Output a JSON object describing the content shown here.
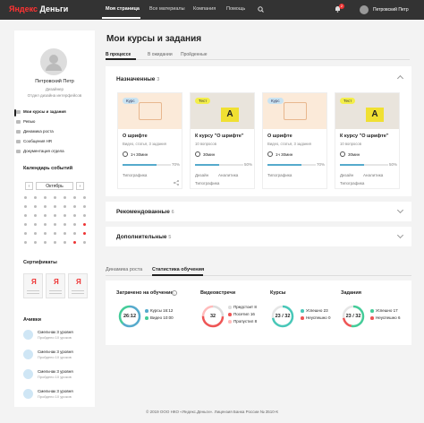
{
  "header": {
    "logo_ya": "Яндекс",
    "logo_rest": "Деньги",
    "nav": [
      "Моя страница",
      "Все материалы",
      "Компания",
      "Помощь"
    ],
    "notifications": "2",
    "user": "Петровский Петр"
  },
  "sidebar": {
    "name": "Петровский Петр",
    "role": "Дизайнер",
    "department": "Отдел дизайна интерфейсов",
    "menu": [
      "Мои курсы и задания",
      "Ревью",
      "Динамика роста",
      "Сообщения HR",
      "Документация отдела"
    ],
    "calendar_title": "Календарь событий",
    "calendar_prev": "‹",
    "calendar_next": "›",
    "calendar_month": "Октябрь",
    "certificates_title": "Сертификаты",
    "achievements_title": "Ачивки",
    "achievements": [
      {
        "title": "Смельчак 3 уровня",
        "sub": "Пройдено 10 уроков"
      },
      {
        "title": "Смельчак 3 уровня",
        "sub": "Пройдено 10 уроков"
      },
      {
        "title": "Смельчак 3 уровня",
        "sub": "Пройдено 10 уроков"
      },
      {
        "title": "Смельчак 3 уровня",
        "sub": "Пройдено 10 уроков"
      }
    ]
  },
  "main": {
    "title": "Мои курсы и задания",
    "tabs": [
      "В процессе",
      "В ожидании",
      "Пройденные"
    ],
    "assigned": {
      "title": "Назначенные",
      "count": "3"
    },
    "cards": [
      {
        "tag": "Курс",
        "title": "О шрифте",
        "meta": "Видео, статья, 3 задания",
        "time": "1ч 30мин",
        "progress": 70,
        "pct": "70%",
        "tags": [
          "Типографика"
        ]
      },
      {
        "tag": "Тест",
        "title": "К курсу \"О шрифте\"",
        "meta": "10 вопросов",
        "time": "30мин",
        "progress": 50,
        "pct": "50%",
        "tags": [
          "Дизайн",
          "Аналитика",
          "Типографика"
        ]
      },
      {
        "tag": "Курс",
        "title": "О шрифте",
        "meta": "Видео, статья, 3 задания",
        "time": "1ч 30мин",
        "progress": 70,
        "pct": "70%",
        "tags": [
          "Типографика"
        ]
      },
      {
        "tag": "Тест",
        "title": "К курсу \"О шрифте\"",
        "meta": "10 вопросов",
        "time": "30мин",
        "progress": 50,
        "pct": "50%",
        "tags": [
          "Дизайн",
          "Аналитика",
          "Типографика"
        ]
      }
    ],
    "recommended": {
      "title": "Рекомендованные",
      "count": "6"
    },
    "additional": {
      "title": "Дополнительные",
      "count": "5"
    },
    "stats_tabs": [
      "Динамика роста",
      "Статистика обучения"
    ],
    "stats": {
      "spent": {
        "title": "Затрачено на обучение",
        "info": "i",
        "value": "26:12",
        "legend": [
          {
            "label": "Курсы",
            "value": "16:12"
          },
          {
            "label": "Видео",
            "value": "10:00"
          }
        ]
      },
      "videos": {
        "title": "Видеовстречи",
        "value": "32",
        "legend": [
          {
            "label": "Предстоит",
            "value": "8"
          },
          {
            "label": "Посетил",
            "value": "16"
          },
          {
            "label": "Пропустил",
            "value": "8"
          }
        ]
      },
      "courses": {
        "title": "Курсы",
        "value": "23 / 32",
        "legend": [
          {
            "label": "Успешно",
            "value": "23"
          },
          {
            "label": "Неуспешно",
            "value": "0"
          }
        ]
      },
      "tasks": {
        "title": "Задания",
        "value": "23 / 32",
        "legend": [
          {
            "label": "Успешно",
            "value": "17"
          },
          {
            "label": "Неуспешно",
            "value": "6"
          }
        ]
      }
    }
  },
  "footer": "© 2019 ООО НКО «Яндекс.Деньги». Лицензия Банка России № 3510-К",
  "colors": {
    "accent": "#e33",
    "blue": "#5ac",
    "green": "#4c9",
    "red": "#e55",
    "teal": "#48c7b8"
  }
}
